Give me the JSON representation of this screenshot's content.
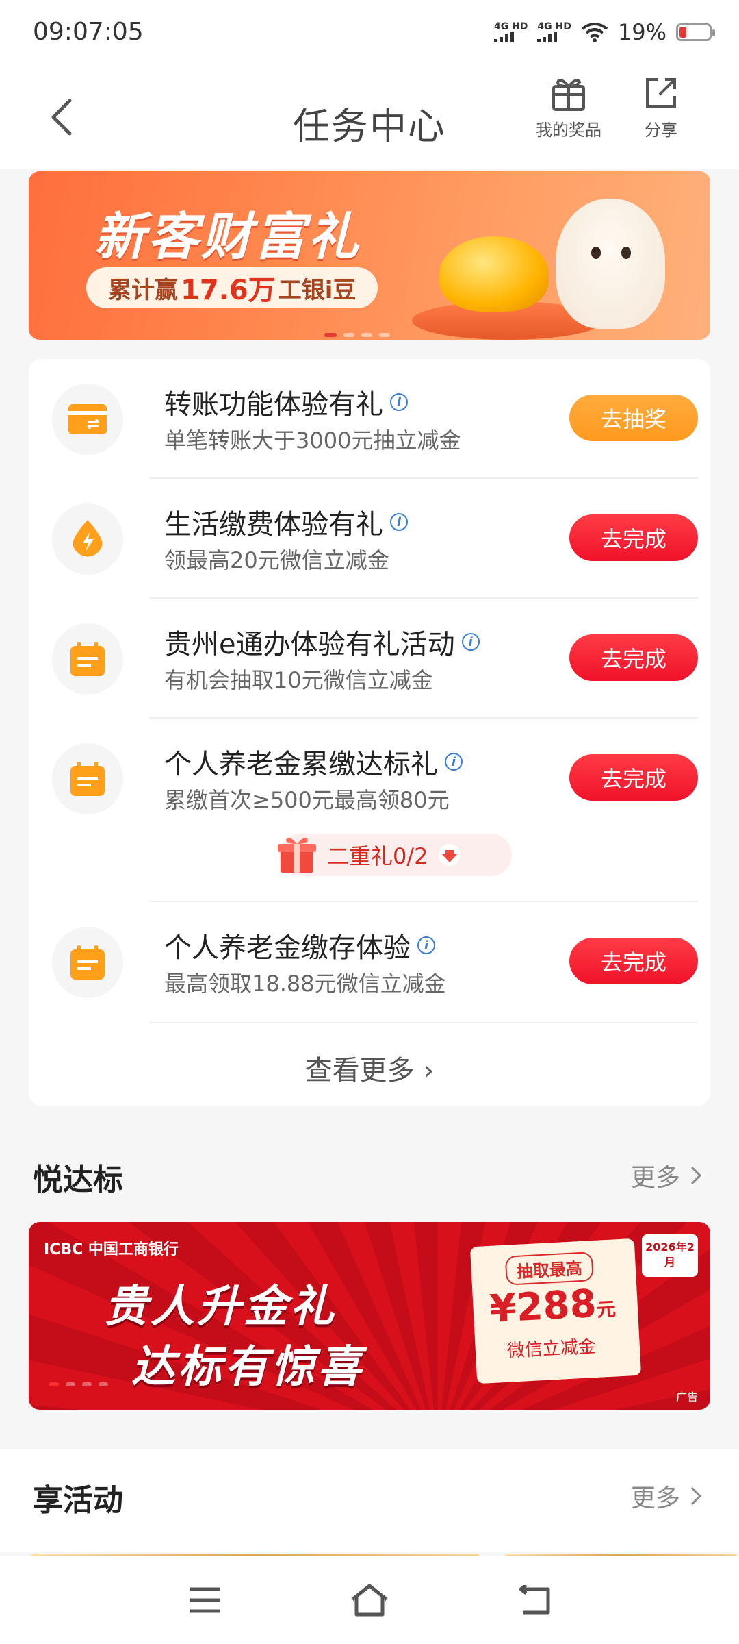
{
  "status_bar": {
    "time": "09:07:05",
    "network1": "4G HD",
    "network2": "4G HD",
    "battery": "19%"
  },
  "header": {
    "title": "任务中心",
    "my_prizes": "我的奖品",
    "share": "分享"
  },
  "banner": {
    "title": "新客财富礼",
    "pill_prefix": "累计赢",
    "pill_amount": "17.6万",
    "pill_suffix": "工银i豆"
  },
  "tasks": [
    {
      "name": "转账功能体验有礼",
      "desc": "单笔转账大于3000元抽立减金",
      "button": "去抽奖",
      "icon": "card-transfer-icon"
    },
    {
      "name": "生活缴费体验有礼",
      "desc": "领最高20元微信立减金",
      "button": "去完成",
      "icon": "lightning-drop-icon"
    },
    {
      "name": "贵州e通办体验有礼活动",
      "desc": "有机会抽取10元微信立减金",
      "button": "去完成",
      "icon": "calendar-icon"
    },
    {
      "name": "个人养老金累缴达标礼",
      "desc": "累缴首次≥500元最高领80元",
      "button": "去完成",
      "icon": "calendar-icon"
    },
    {
      "name": "个人养老金缴存体验",
      "desc": "最高领取18.88元微信立减金",
      "button": "去完成",
      "icon": "calendar-icon"
    }
  ],
  "gift_badge": "二重礼0/2",
  "view_more": "查看更多",
  "section1": {
    "title": "悦达标",
    "more": "更多"
  },
  "ad": {
    "brand": "ICBC 中国工商银行",
    "line1": "贵人升金礼",
    "line2": "达标有惊喜",
    "tag": "抽取最高",
    "amount": "¥288",
    "unit": "元",
    "desc": "微信立减金",
    "date": "2026年2月",
    "ad_label": "广告"
  },
  "section2": {
    "title": "享活动",
    "more": "更多"
  },
  "colors": {
    "accent_red": "#f0122a",
    "accent_orange": "#ff9a1f",
    "icon_orange": "#ff9f1a"
  }
}
